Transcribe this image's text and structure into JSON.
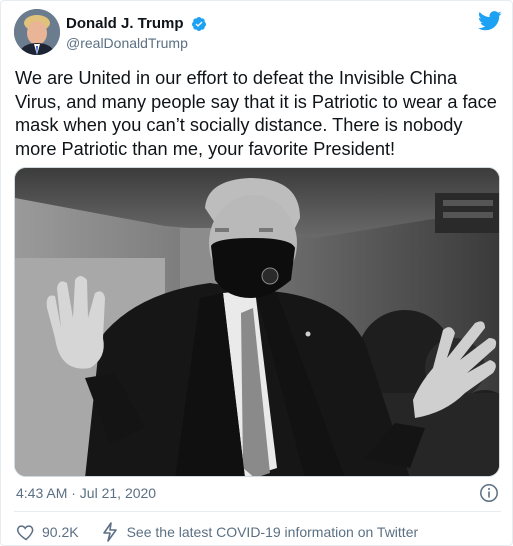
{
  "author": {
    "display_name": "Donald J. Trump",
    "handle": "@realDonaldTrump",
    "verified": true
  },
  "tweet": {
    "text": "We are United in our effort to defeat the Invisible China Virus, and many people say that it is Patriotic to wear a face mask when you can’t socially distance. There is nobody more Patriotic than me, your favorite President!"
  },
  "meta": {
    "timestamp": "4:43 AM · Jul 21, 2020"
  },
  "actions": {
    "likes": "90.2K",
    "covid_info": "See the latest COVID-19 information on Twitter"
  },
  "colors": {
    "twitter_blue": "#1da1f2",
    "muted": "#5b7083"
  },
  "icons": [
    "twitter-bird-icon",
    "verified-badge-icon",
    "info-icon",
    "heart-icon",
    "lightning-icon"
  ]
}
